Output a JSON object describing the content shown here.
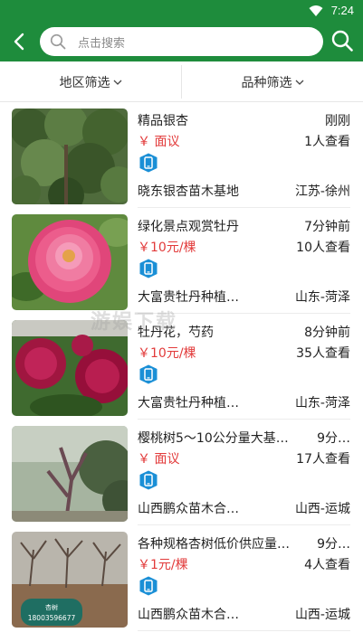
{
  "status_bar": {
    "time": "7:24",
    "signal_icon": "wifi-icon"
  },
  "header": {
    "back_icon": "back-arrow-icon",
    "search_placeholder": "点击搜索",
    "search_icon": "search-icon"
  },
  "filters": {
    "region": "地区筛选",
    "variety": "品种筛选"
  },
  "colors": {
    "brand_green": "#1e8c3c",
    "price_red": "#e23a3a",
    "badge_blue": "#1a8fd6"
  },
  "watermark": {
    "text": "游娱下载"
  },
  "listings": [
    {
      "title": "精品银杏",
      "time": "刚刚",
      "price": "￥ 面议",
      "views": "1人查看",
      "company": "晓东银杏苗木基地",
      "region": "江苏-徐州",
      "thumb": "tree"
    },
    {
      "title": "绿化景点观赏牡丹",
      "time": "7分钟前",
      "price": "￥10元/棵",
      "views": "10人查看",
      "company": "大富贵牡丹种植…",
      "region": "山东-菏泽",
      "thumb": "peony-pink"
    },
    {
      "title": "牡丹花，芍药",
      "time": "8分钟前",
      "price": "￥10元/棵",
      "views": "35人查看",
      "company": "大富贵牡丹种植…",
      "region": "山东-菏泽",
      "thumb": "peony-red"
    },
    {
      "title": "樱桃树5～10公分量大基…",
      "time": "9分…",
      "price": "￥ 面议",
      "views": "17人查看",
      "company": "山西鹏众苗木合…",
      "region": "山西-运城",
      "thumb": "cherry"
    },
    {
      "title": "各种规格杏树低价供应量…",
      "time": "9分…",
      "price": "￥1元/棵",
      "views": "4人查看",
      "company": "山西鹏众苗木合…",
      "region": "山西-运城",
      "thumb": "apricot",
      "thumb_label": "杏树",
      "thumb_phone": "18003596677"
    }
  ]
}
